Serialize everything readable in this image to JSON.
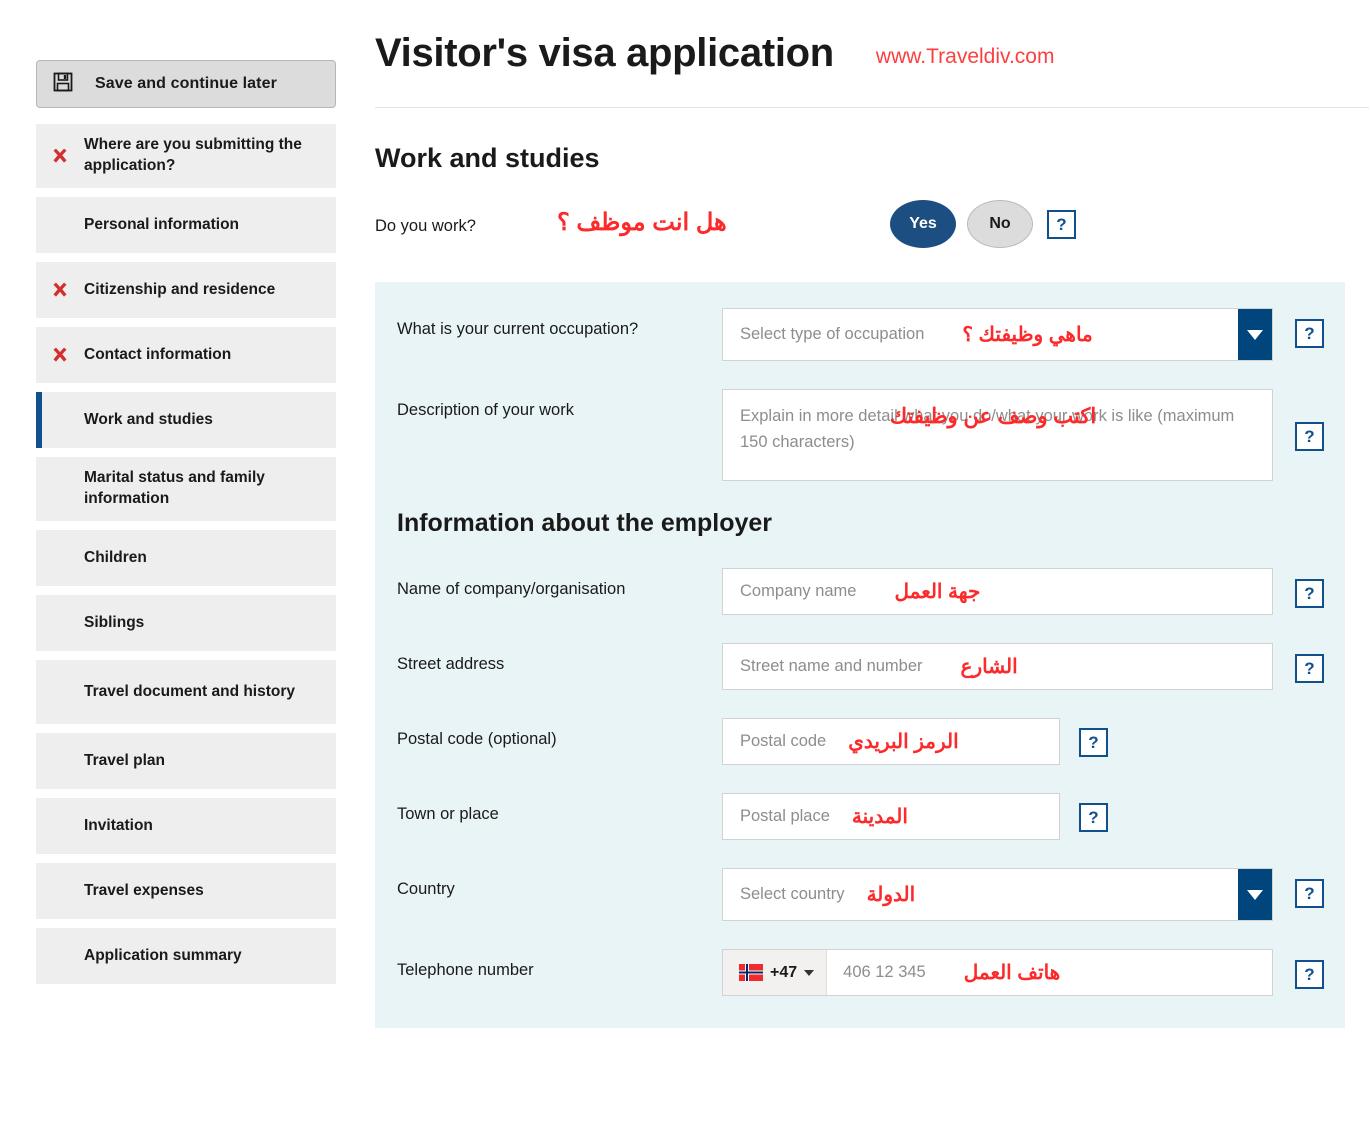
{
  "sidebar": {
    "save_label": "Save and continue later",
    "save_icon": "floppy-disk-icon",
    "items": [
      {
        "label": "Where are you submitting the application?",
        "status": "error",
        "active": false
      },
      {
        "label": "Personal information",
        "status": "none",
        "active": false
      },
      {
        "label": "Citizenship and residence",
        "status": "error",
        "active": false
      },
      {
        "label": "Contact information",
        "status": "error",
        "active": false
      },
      {
        "label": "Work and studies",
        "status": "none",
        "active": true
      },
      {
        "label": "Marital status and family information",
        "status": "none",
        "active": false
      },
      {
        "label": "Children",
        "status": "none",
        "active": false
      },
      {
        "label": "Siblings",
        "status": "none",
        "active": false
      },
      {
        "label": "Travel document and history",
        "status": "none",
        "active": false
      },
      {
        "label": "Travel plan",
        "status": "none",
        "active": false
      },
      {
        "label": "Invitation",
        "status": "none",
        "active": false
      },
      {
        "label": "Travel expenses",
        "status": "none",
        "active": false
      },
      {
        "label": "Application summary",
        "status": "none",
        "active": false
      }
    ]
  },
  "header": {
    "title": "Visitor's visa application",
    "site_url": "www.Traveldiv.com",
    "section_title": "Work and studies"
  },
  "work_question": {
    "label": "Do you work?",
    "annotation_ar": "هل انت موظف ؟",
    "yes_label": "Yes",
    "no_label": "No",
    "selected": "Yes",
    "help_label": "?"
  },
  "occupation": {
    "label": "What is your current occupation?",
    "value": "Select type of occupation",
    "annotation_ar": "ماهي وظيفتك ؟",
    "help_label": "?"
  },
  "description": {
    "label": "Description of your work",
    "placeholder_line1": "Explain in more detail what you do/what your work is like (maximum",
    "placeholder_line2": "150 characters)",
    "annotation_ar": "اكتب وصف عن وظيفتك",
    "help_label": "?"
  },
  "employer": {
    "title": "Information about the employer",
    "company": {
      "label": "Name of company/organisation",
      "placeholder": "Company name",
      "annotation_ar": "جهة العمل",
      "help_label": "?"
    },
    "street": {
      "label": "Street address",
      "placeholder": "Street name and number",
      "annotation_ar": "الشارع",
      "help_label": "?"
    },
    "postal_code": {
      "label": "Postal code (optional)",
      "placeholder": "Postal code",
      "annotation_ar": "الرمز البريدي",
      "help_label": "?"
    },
    "town": {
      "label": "Town or place",
      "placeholder": "Postal place",
      "annotation_ar": "المدينة",
      "help_label": "?"
    },
    "country": {
      "label": "Country",
      "value": "Select country",
      "annotation_ar": "الدولة",
      "help_label": "?"
    },
    "telephone": {
      "label": "Telephone number",
      "country_code": "+47",
      "flag": "norway-flag-icon",
      "placeholder": "406 12 345",
      "annotation_ar": "هاتف العمل",
      "help_label": "?"
    }
  },
  "colors": {
    "accent_blue": "#10508c",
    "select_arrow_blue": "#00457c",
    "yes_blue": "#1c4e82",
    "annotation_red": "#fc2a2a",
    "url_red": "#fc4040",
    "panel_bg": "#e9f4f7",
    "nav_bg": "#eeeeee",
    "error_x_red": "#d32f2f"
  }
}
